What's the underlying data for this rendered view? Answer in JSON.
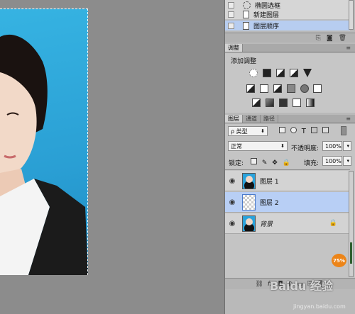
{
  "history": {
    "items": [
      {
        "label": "椭圆选框",
        "icon": "ellipse-marquee-icon"
      },
      {
        "label": "新建图层",
        "icon": "document-icon"
      },
      {
        "label": "图层顺序",
        "icon": "document-icon",
        "selected": true
      }
    ]
  },
  "adjustments": {
    "tab": "调整",
    "title": "添加调整"
  },
  "layers_panel": {
    "tabs": [
      "图层",
      "通道",
      "路径"
    ],
    "filter": "ρ 类型",
    "blend_mode": "正常",
    "opacity_label": "不透明度:",
    "opacity_value": "100%",
    "lock_label": "锁定:",
    "fill_label": "填充:",
    "fill_value": "100%",
    "layers": [
      {
        "name": "图层 1",
        "thumb": "portrait",
        "selected": false,
        "italic": false
      },
      {
        "name": "图层 2",
        "thumb": "transparent",
        "selected": true,
        "italic": false
      },
      {
        "name": "背景",
        "thumb": "portrait",
        "selected": false,
        "italic": true,
        "locked": true
      }
    ],
    "bottom_icons": [
      "link-icon",
      "fx-icon",
      "mask-icon",
      "adjustment-icon",
      "folder-icon",
      "new-layer-icon",
      "trash-icon"
    ],
    "bottom_fx": "fx"
  },
  "zoom_badge": "75%",
  "watermark": {
    "text": "Baidu 经验",
    "url": "jingyan.baidu.com"
  },
  "colors": {
    "panel": "#b9b9b9",
    "selected": "#b8cff5",
    "canvas_bg": "#8c8c8c",
    "photo_bg": "#2aa3dc",
    "badge": "#ec8418"
  }
}
